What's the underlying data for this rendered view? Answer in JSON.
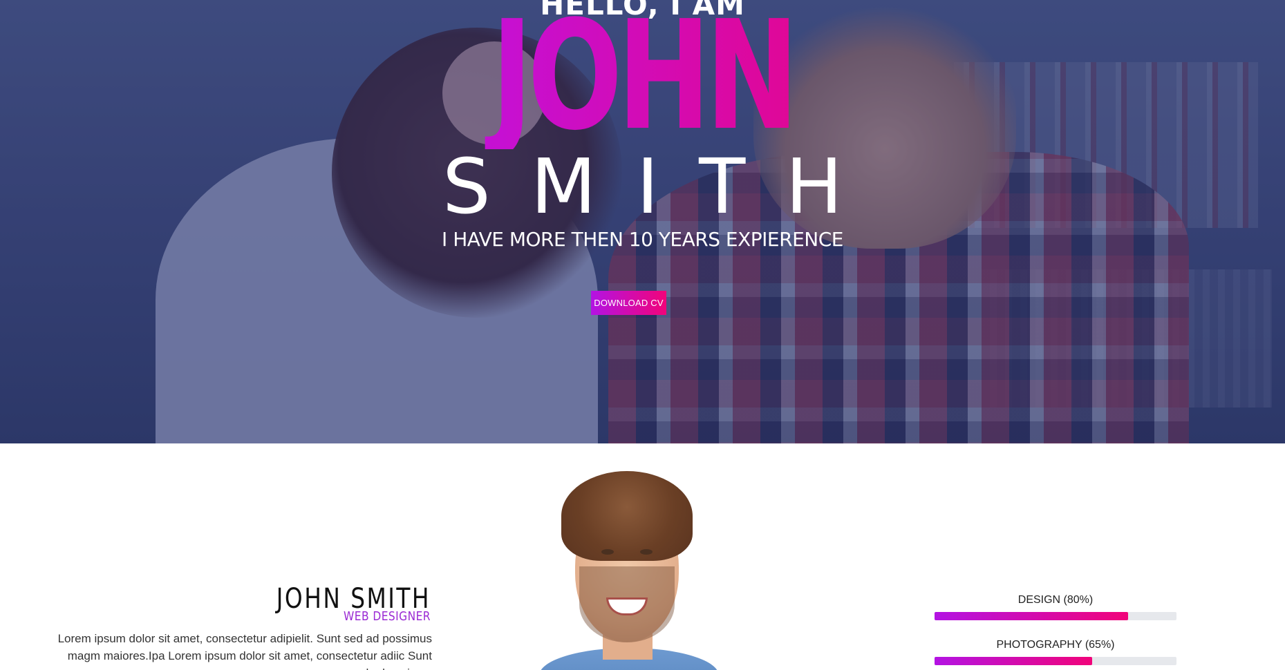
{
  "hero": {
    "greeting": "HELLO, I AM",
    "first_name": "JOHN",
    "last_name": "SMITH",
    "tagline": "I HAVE MORE THEN 10 YEARS EXPIERENCE",
    "cta_label": "DOWNLOAD CV",
    "gradient_start": "#b313e3",
    "gradient_end": "#f1047a"
  },
  "about": {
    "name": "JOHN SMITH",
    "role": "WEB DESIGNER",
    "bio": "Lorem ipsum dolor sit amet, consectetur adipielit. Sunt sed ad possimus magm maiores.Ipa Lorem ipsum dolor sit amet, consectetur adiic Sunt sed ad posimus"
  },
  "skills": [
    {
      "label": "DESIGN (80%)",
      "percent": 80
    },
    {
      "label": "PHOTOGRAPHY (65%)",
      "percent": 65
    }
  ]
}
